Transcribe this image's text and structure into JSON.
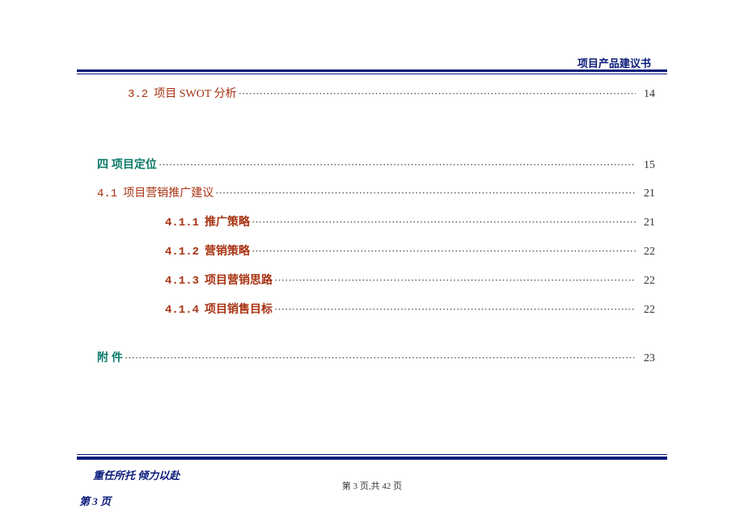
{
  "header": {
    "title": "项目产品建议书"
  },
  "toc": {
    "e32": {
      "num": "3.2",
      "txt": "项目 SWOT 分析",
      "page": "14"
    },
    "s4": {
      "head": "四 项目定位",
      "page": "15"
    },
    "e41": {
      "num": "4.1",
      "txt": "项目营销推广建议",
      "page": "21"
    },
    "e411": {
      "num": "4.1.1",
      "txt": "推广策略",
      "page": "21"
    },
    "e412": {
      "num": "4.1.2",
      "txt": "营销策略",
      "page": "22"
    },
    "e413": {
      "num": "4.1.3",
      "txt": "项目营销思路",
      "page": "22"
    },
    "e414": {
      "num": "4.1.4",
      "txt": "项目销售目标",
      "page": "22"
    },
    "appx": {
      "head": "附  件",
      "page": "23"
    }
  },
  "dots": "··································································································································································",
  "footer": {
    "motto": "重任所托    倾力以赴",
    "center": "第 3 页,共 42 页",
    "left": "第 3 页"
  }
}
